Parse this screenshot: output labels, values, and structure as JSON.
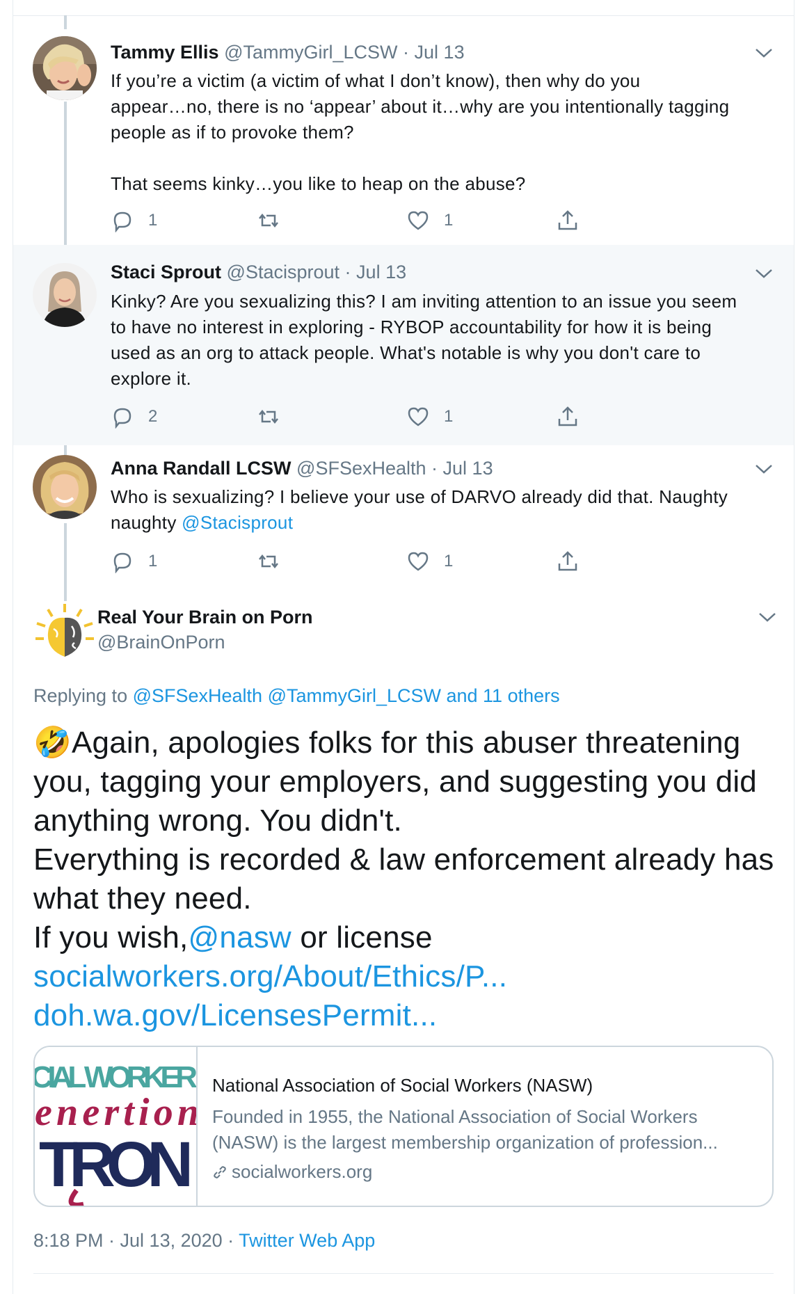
{
  "replies": [
    {
      "name": "Tammy Ellis",
      "handle": "@TammyGirl_LCSW",
      "date": "Jul 13",
      "body": [
        "If you’re a victim (a victim of what I don’t know), then why do you",
        "appear…no, there is no ‘appear’ about it…why are you intentionally tagging",
        "people as if to provoke them?",
        "",
        "That seems kinky…you like to heap on the abuse?"
      ],
      "reply_count": "1",
      "retweet_count": "",
      "like_count": "1"
    },
    {
      "name": "Staci Sprout",
      "handle": "@Stacisprout",
      "date": "Jul 13",
      "body": [
        "Kinky? Are you sexualizing this? I am inviting attention to an issue you seem",
        "to have no interest in exploring - RYBOP accountability for how it is being",
        "used as an org to attack people. What's notable is why you don't care to",
        "explore it."
      ],
      "reply_count": "2",
      "retweet_count": "",
      "like_count": "1"
    },
    {
      "name": "Anna Randall LCSW",
      "handle": "@SFSexHealth",
      "date": "Jul 13",
      "body_line1": "Who is sexualizing? I believe your use of DARVO already did that. Naughty",
      "body_line2_text": "naughty ",
      "body_line2_mention": "@Stacisprout",
      "reply_count": "1",
      "retweet_count": "",
      "like_count": "1"
    }
  ],
  "main_tweet": {
    "name": "Real Your Brain on Porn",
    "handle": "@BrainOnPorn",
    "replying_prefix": "Replying to ",
    "replying_mentions": "@SFSexHealth @TammyGirl_LCSW and 11 others",
    "emoji": "🤣",
    "line1": "Again, apologies folks for this abuser threatening",
    "line2": "you, tagging your employers, and suggesting you did",
    "line3": "anything wrong. You didn't.",
    "line4": "Everything is recorded & law enforcement already has",
    "line5": "what they need.",
    "line6_text": "If you wish,",
    "line6_mention": "@nasw",
    "line6_tail": " or license",
    "link1": "socialworkers.org/About/Ethics/P...",
    "link2": "doh.wa.gov/LicensesPermit...",
    "timestamp_prefix": "8:18 PM · Jul 13, 2020 · ",
    "source": "Twitter Web App"
  },
  "card": {
    "thumb_line1": "CIAL WORKER",
    "thumb_line2": "enertion",
    "thumb_line3": "TRON",
    "title": "National Association of Social Workers (NASW)",
    "desc1": "Founded in 1955, the National Association of Social Workers",
    "desc2": "(NASW) is the largest membership organization of profession...",
    "url": "socialworkers.org"
  },
  "icons": [
    "reply-icon",
    "retweet-icon",
    "like-icon",
    "share-icon",
    "chevron-down-icon",
    "link-icon"
  ],
  "colors": {
    "link": "#1b95e0",
    "muted": "#657786",
    "highlight_bg": "#f5f8fa",
    "border": "#ccd6dd"
  }
}
